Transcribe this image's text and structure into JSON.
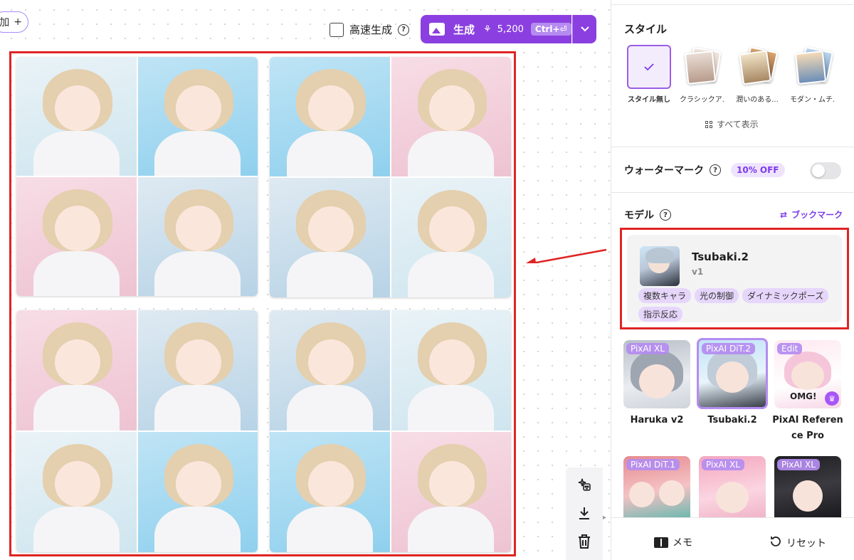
{
  "toolbar": {
    "add_chip_label": "加",
    "add_chip_plus": "+",
    "fast_gen_label": "高速生成",
    "help": "?",
    "generate_label": "生成",
    "credits": "5,200",
    "shortcut": "Ctrl+⏎",
    "dropdown": "⌄"
  },
  "results": {
    "card_count": 4
  },
  "side_tools": {
    "tools": [
      "magic-edit-icon",
      "download-icon",
      "trash-icon"
    ]
  },
  "panel": {
    "style": {
      "title": "スタイル",
      "items": [
        {
          "label": "スタイル無し",
          "selected": true
        },
        {
          "label": "クラシックア..."
        },
        {
          "label": "潤いのある..."
        },
        {
          "label": "モダン・ムチ..."
        }
      ],
      "show_all": "すべて表示"
    },
    "watermark": {
      "title": "ウォーターマーク",
      "badge": "10% OFF",
      "enabled": false
    },
    "model": {
      "title": "モデル",
      "bookmark": "ブックマーク",
      "selected": {
        "name": "Tsubaki.2",
        "version": "v1",
        "tags": [
          "複数キャラ",
          "光の制御",
          "ダイナミックポーズ",
          "指示反応"
        ]
      },
      "cards": [
        {
          "badge": "PixAI XL",
          "name": "Haruka v2"
        },
        {
          "badge": "PixAI DiT.2",
          "name": "Tsubaki.2"
        },
        {
          "badge": "Edit",
          "name": "PixAI Reference Pro",
          "name_line1": "PixAI Referen",
          "name_line2": "ce Pro",
          "omg": "OMG!"
        },
        {
          "badge": "PixAI DiT.1"
        },
        {
          "badge": "PixAI XL"
        },
        {
          "badge": "PixAI XL"
        }
      ]
    },
    "bottom": {
      "memo": "メモ",
      "reset": "リセット"
    }
  },
  "colors": {
    "accent": "#8b3fe0",
    "highlight_frame": "#e02424",
    "tag_bg": "#e6d6fb"
  }
}
